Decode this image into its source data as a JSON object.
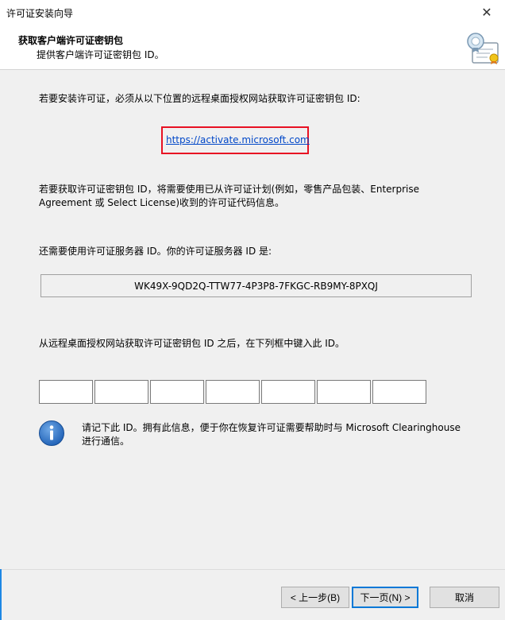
{
  "window": {
    "title": "许可证安装向导",
    "close_glyph": "✕"
  },
  "header": {
    "title": "获取客户端许可证密钥包",
    "subtitle": "提供客户端许可证密钥包 ID。"
  },
  "main": {
    "intro": "若要安装许可证，必须从以下位置的远程桌面授权网站获取许可证密钥包 ID:",
    "link": "https://activate.microsoft.com",
    "keypack_info_line1": "若要获取许可证密钥包 ID，将需要使用已从许可证计划(例如，零售产品包装、Enterprise",
    "keypack_info_line2": "Agreement 或 Select License)收到的许可证代码信息。",
    "server_label": "还需要使用许可证服务器 ID。你的许可证服务器 ID 是:",
    "server_id": "WK49X-9QD2Q-TTW77-4P3P8-7FKGC-RB9MY-8PXQJ",
    "enter_label": "从远程桌面授权网站获取许可证密钥包 ID 之后，在下列框中键入此 ID。",
    "id_fields": [
      "",
      "",
      "",
      "",
      "",
      "",
      ""
    ],
    "note_line1": "请记下此 ID。拥有此信息，便于你在恢复许可证需要帮助时与 Microsoft Clearinghouse",
    "note_line2": "进行通信。"
  },
  "buttons": {
    "back": "< 上一步(B)",
    "next": "下一页(N) >",
    "cancel": "取消"
  },
  "colors": {
    "link": "#0047c8",
    "highlight_border": "#e81123",
    "primary_border": "#0078d7"
  },
  "icons": {
    "header": "certificate-icon",
    "note": "info-icon",
    "close": "close-icon"
  }
}
